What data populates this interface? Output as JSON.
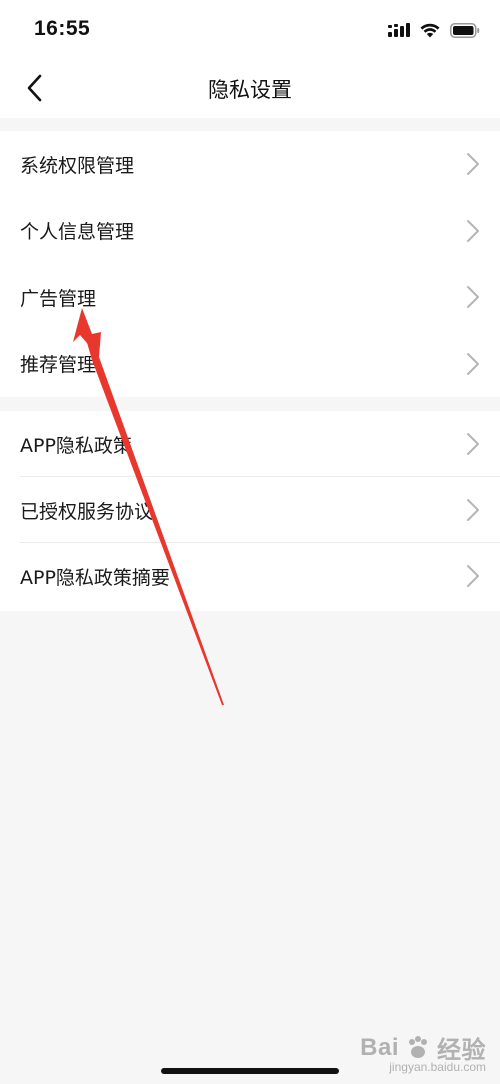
{
  "status_bar": {
    "time": "16:55",
    "icons": [
      "signal-icon",
      "wifi-icon",
      "battery-icon"
    ]
  },
  "nav": {
    "title": "隐私设置",
    "back_icon": "chevron-left-icon"
  },
  "groups": [
    {
      "items": [
        {
          "label": "系统权限管理"
        },
        {
          "label": "个人信息管理"
        },
        {
          "label": "广告管理"
        },
        {
          "label": "推荐管理"
        }
      ]
    },
    {
      "items": [
        {
          "label": "APP隐私政策"
        },
        {
          "label": "已授权服务协议"
        },
        {
          "label": "APP隐私政策摘要"
        }
      ]
    }
  ],
  "annotation": {
    "color": "#e8372c",
    "points_to": "广告管理"
  },
  "watermark": {
    "text": "Bai",
    "suffix": "经验",
    "sub": "jingyan.baidu.com"
  },
  "colors": {
    "background": "#f6f6f6",
    "surface": "#ffffff",
    "text": "#1a1a1a",
    "chevron": "#b5b5b5",
    "divider": "#ececec"
  }
}
